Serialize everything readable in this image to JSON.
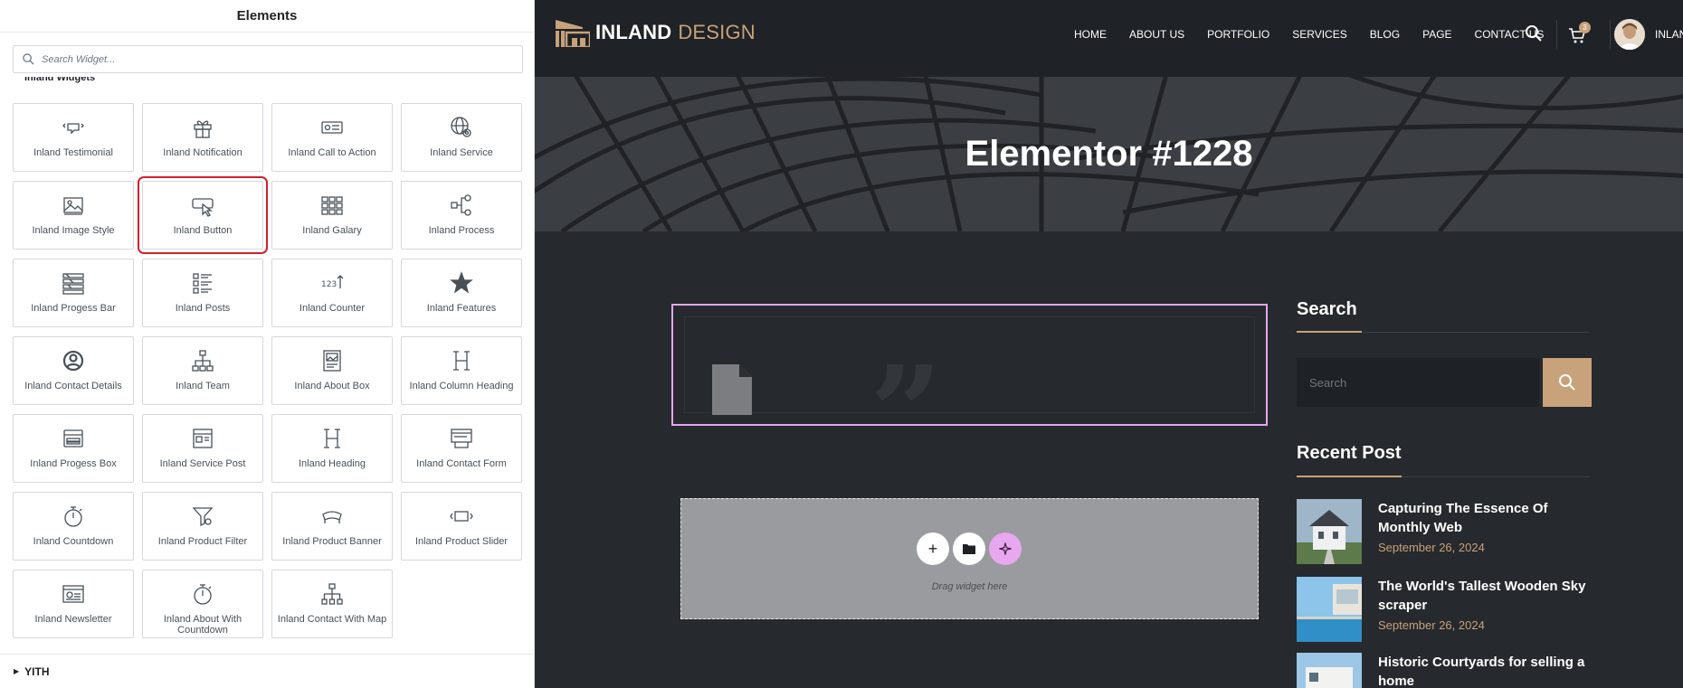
{
  "panel": {
    "title": "Elements",
    "search_placeholder": "Search Widget...",
    "category_label": "Inland Widgets",
    "widgets": [
      {
        "label": "Inland Testimonial",
        "icon": "testimonial-icon"
      },
      {
        "label": "Inland Notification",
        "icon": "gift-icon"
      },
      {
        "label": "Inland Call to Action",
        "icon": "call-to-action-icon"
      },
      {
        "label": "Inland Service",
        "icon": "globe-gear-icon"
      },
      {
        "label": "Inland Image Style",
        "icon": "image-icon"
      },
      {
        "label": "Inland Button",
        "icon": "button-cursor-icon",
        "selected": true
      },
      {
        "label": "Inland Galary",
        "icon": "gallery-grid-icon"
      },
      {
        "label": "Inland Process",
        "icon": "process-flow-icon"
      },
      {
        "label": "Inland Progess Bar",
        "icon": "progress-bar-icon"
      },
      {
        "label": "Inland Posts",
        "icon": "posts-list-icon"
      },
      {
        "label": "Inland Counter",
        "icon": "counter-icon"
      },
      {
        "label": "Inland Features",
        "icon": "star-icon"
      },
      {
        "label": "Inland Contact Details",
        "icon": "user-circle-icon"
      },
      {
        "label": "Inland Team",
        "icon": "org-chart-icon"
      },
      {
        "label": "Inland About Box",
        "icon": "about-box-icon"
      },
      {
        "label": "Inland Column Heading",
        "icon": "heading-icon"
      },
      {
        "label": "Inland Progess Box",
        "icon": "progress-box-icon"
      },
      {
        "label": "Inland Service Post",
        "icon": "service-post-icon"
      },
      {
        "label": "Inland Heading",
        "icon": "heading-icon"
      },
      {
        "label": "Inland Contact Form",
        "icon": "contact-form-icon"
      },
      {
        "label": "Inland Countdown",
        "icon": "stopwatch-icon"
      },
      {
        "label": "Inland Product Filter",
        "icon": "filter-icon"
      },
      {
        "label": "Inland Product Banner",
        "icon": "product-banner-icon"
      },
      {
        "label": "Inland Product Slider",
        "icon": "product-slider-icon"
      },
      {
        "label": "Inland Newsletter",
        "icon": "newsletter-icon"
      },
      {
        "label": "Inland About With Countdown",
        "icon": "stopwatch-icon"
      },
      {
        "label": "Inland Contact With Map",
        "icon": "network-map-icon"
      }
    ],
    "yith_label": "YITH"
  },
  "site": {
    "logo_word1": "INLAND",
    "logo_word2": "DESIGN",
    "nav": [
      "HOME",
      "ABOUT US",
      "PORTFOLIO",
      "SERVICES",
      "BLOG",
      "PAGE",
      "CONTACT US"
    ],
    "cart_count": "3",
    "user_name": "INLAND",
    "hero_title": "Elementor #1228",
    "quote_glyph": "”",
    "drop_zone": {
      "add_symbol": "+",
      "text": "Drag widget here"
    },
    "sidebar": {
      "search_heading": "Search",
      "search_placeholder": "Search",
      "recent_heading": "Recent Post",
      "posts": [
        {
          "title": "Capturing The Essence Of Monthly Web",
          "date": "September 26, 2024"
        },
        {
          "title": "The World's Tallest Wooden Sky scraper",
          "date": "September 26, 2024"
        },
        {
          "title": "Historic Courtyards for selling a home",
          "date": ""
        }
      ]
    }
  },
  "colors": {
    "accent": "#c7a27a",
    "selection": "#d3202a",
    "edit_outline": "#e3a8e8",
    "ai_button": "#e9a7f0"
  }
}
